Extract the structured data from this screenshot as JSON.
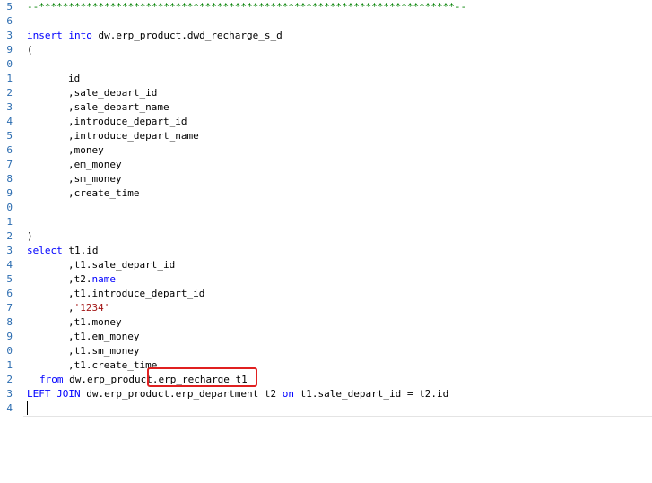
{
  "editor": {
    "line_numbers": [
      "5",
      "6",
      "3",
      "9",
      "0",
      "1",
      "2",
      "3",
      "4",
      "5",
      "6",
      "7",
      "8",
      "9",
      "0",
      "1",
      "2",
      "3",
      "4",
      "5",
      "6",
      "7",
      "8",
      "9",
      "0",
      "1",
      "2",
      "3",
      "4"
    ],
    "comment_line": "--**********************************************************************--",
    "insert_into_kw": "insert into",
    "insert_target": " dw.erp_product.dwd_recharge_s_d",
    "open_paren": "(",
    "cols": [
      "id",
      ",sale_depart_id",
      ",sale_depart_name",
      ",introduce_depart_id",
      ",introduce_depart_name",
      ",money",
      ",em_money",
      ",sm_money",
      ",create_time"
    ],
    "close_paren": ")",
    "select_kw": "select",
    "select_first": " t1.id",
    "sel_sale_depart_id": ",t1.sale_depart_id",
    "sel_t2_prefix": ",t2.",
    "sel_t2_name": "name",
    "sel_comma": ",",
    "sel_literal": "'1234'",
    "sel_money": ",t1.money",
    "sel_em_money": ",t1.em_money",
    "sel_sm_money": ",t1.sm_money",
    "sel_create_time": ",t1.create_time",
    "from_kw": "from",
    "from_table": " dw.erp_product.erp_recharge t1",
    "left_join_kw": "LEFT JOIN",
    "join_table": " dw.erp_product.erp_department t2 ",
    "on_kw": "on",
    "join_cond": " t1.sale_depart_id = t2.id"
  }
}
